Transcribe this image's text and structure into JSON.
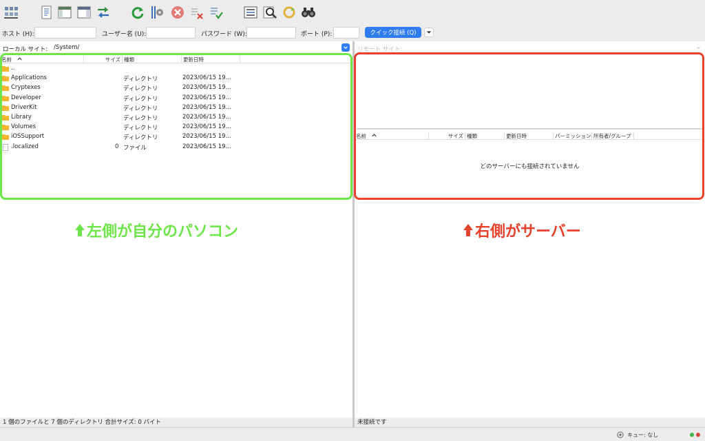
{
  "connection": {
    "host_label": "ホスト (H):",
    "user_label": "ユーザー名 (U):",
    "password_label": "パスワード (W):",
    "port_label": "ポート (P):",
    "quick_connect": "クイック接続 (Q)"
  },
  "local": {
    "site_label": "ローカル サイト:",
    "path": "/System/",
    "columns": {
      "name": "名前",
      "size": "サイズ",
      "type": "種類",
      "modified": "更新日時"
    },
    "files": [
      {
        "name": "..",
        "size": "",
        "type": "",
        "modified": "",
        "kind": "folder"
      },
      {
        "name": "Applications",
        "size": "",
        "type": "ディレクトリ",
        "modified": "2023/06/15 19...",
        "kind": "folder"
      },
      {
        "name": "Cryptexes",
        "size": "",
        "type": "ディレクトリ",
        "modified": "2023/06/15 19...",
        "kind": "folder"
      },
      {
        "name": "Developer",
        "size": "",
        "type": "ディレクトリ",
        "modified": "2023/06/15 19...",
        "kind": "folder"
      },
      {
        "name": "DriverKit",
        "size": "",
        "type": "ディレクトリ",
        "modified": "2023/06/15 19...",
        "kind": "folder"
      },
      {
        "name": "Library",
        "size": "",
        "type": "ディレクトリ",
        "modified": "2023/06/15 19...",
        "kind": "folder"
      },
      {
        "name": "Volumes",
        "size": "",
        "type": "ディレクトリ",
        "modified": "2023/06/15 19...",
        "kind": "folder"
      },
      {
        "name": "iOSSupport",
        "size": "",
        "type": "ディレクトリ",
        "modified": "2023/06/15 19...",
        "kind": "folder"
      },
      {
        "name": ".localized",
        "size": "0",
        "type": "ファイル",
        "modified": "2023/06/15 19...",
        "kind": "file"
      }
    ],
    "status": "1 個のファイルと 7 個のディレクトリ 合計サイズ: 0 バイト"
  },
  "remote": {
    "site_label": "リモート サイト:",
    "columns": {
      "name": "名前",
      "size": "サイズ",
      "type": "種類",
      "modified": "更新日時",
      "permissions": "パーミッション",
      "owner": "所有者/グループ"
    },
    "empty_message": "どのサーバーにも接続されていません",
    "status": "未接続です"
  },
  "queue": {
    "label": "キュー: なし"
  },
  "annotations": {
    "left_caption": "左側が自分のパソコン",
    "right_caption": "右側がサーバー",
    "left_color": "#6ee64a",
    "right_color": "#e8422d"
  },
  "icons": [
    "site-manager-icon",
    "message-log-icon",
    "local-tree-icon",
    "remote-tree-icon",
    "transfer-queue-icon",
    "refresh-icon",
    "process-queue-icon",
    "cancel-icon",
    "disconnect-icon",
    "reconnect-icon",
    "dir-listing-filter-icon",
    "directory-compare-icon",
    "sync-browsing-icon",
    "search-icon"
  ]
}
